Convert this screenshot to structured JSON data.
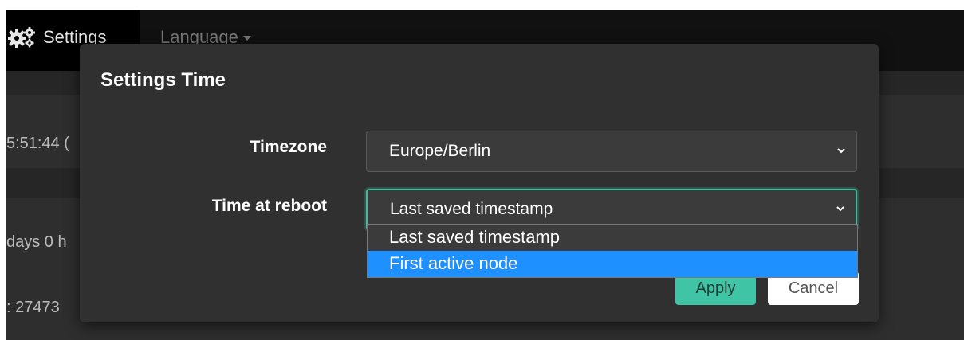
{
  "navbar": {
    "settings_label": "Settings",
    "language_label": "Language"
  },
  "background": {
    "row1_text": "5:51:44 (",
    "row2_text": "days 0 h",
    "row3_text": ": 27473"
  },
  "modal": {
    "title": "Settings Time",
    "timezone": {
      "label": "Timezone",
      "value": "Europe/Berlin"
    },
    "time_at_reboot": {
      "label": "Time at reboot",
      "value": "Last saved timestamp",
      "options": [
        "Last saved timestamp",
        "First active node"
      ],
      "highlighted_index": 1
    },
    "apply_label": "Apply",
    "cancel_label": "Cancel"
  },
  "colors": {
    "accent": "#3fc5a5",
    "highlight": "#1e90ff",
    "modal_bg": "#303030"
  },
  "icons": {
    "settings": "gears-icon",
    "language_caret": "caret-down-icon",
    "select_chevron": "chevron-down-icon"
  }
}
